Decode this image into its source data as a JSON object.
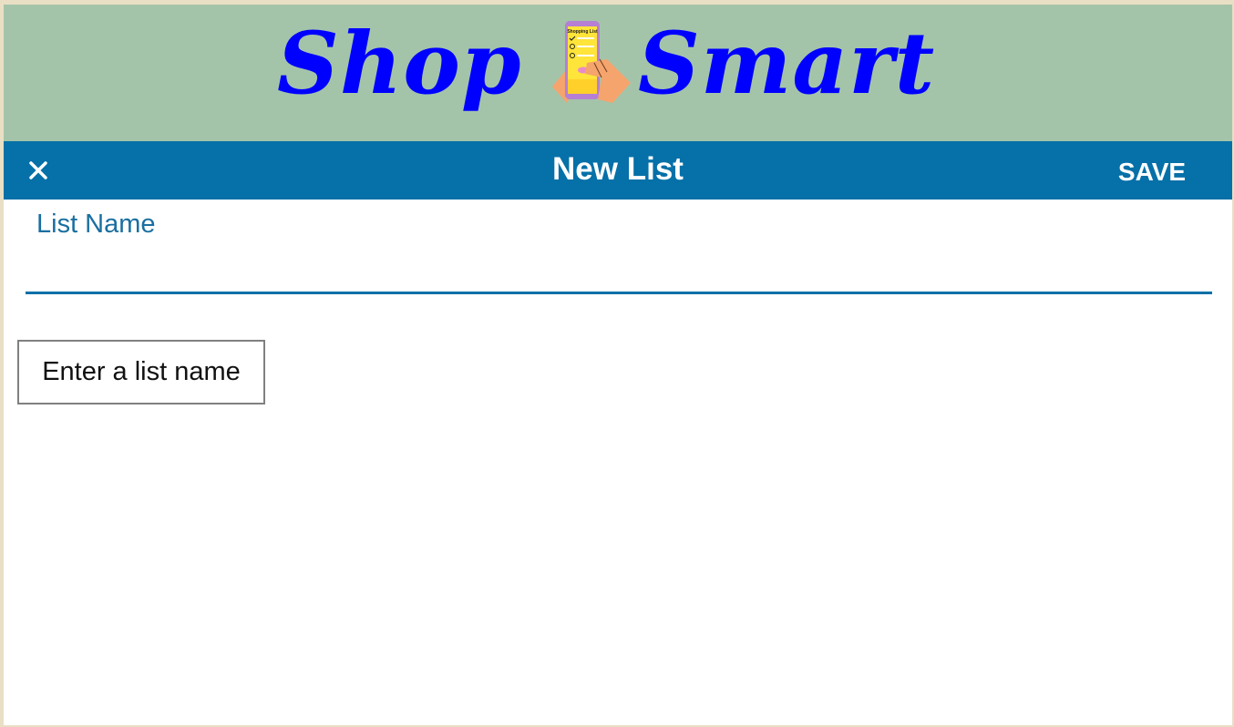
{
  "header": {
    "logo_left": "Shop",
    "logo_right": "Smart",
    "logo_icon": "hands-holding-phone-icon",
    "phone_screen_text": "Shopping List",
    "banner_color": "#a4c4aa",
    "logo_color": "#0000ff"
  },
  "toolbar": {
    "close_icon": "close-icon",
    "title": "New List",
    "save_label": "SAVE",
    "background_color": "#0670a8"
  },
  "form": {
    "list_name_label": "List Name",
    "list_name_value": "",
    "validation_message": "Enter a list name"
  }
}
